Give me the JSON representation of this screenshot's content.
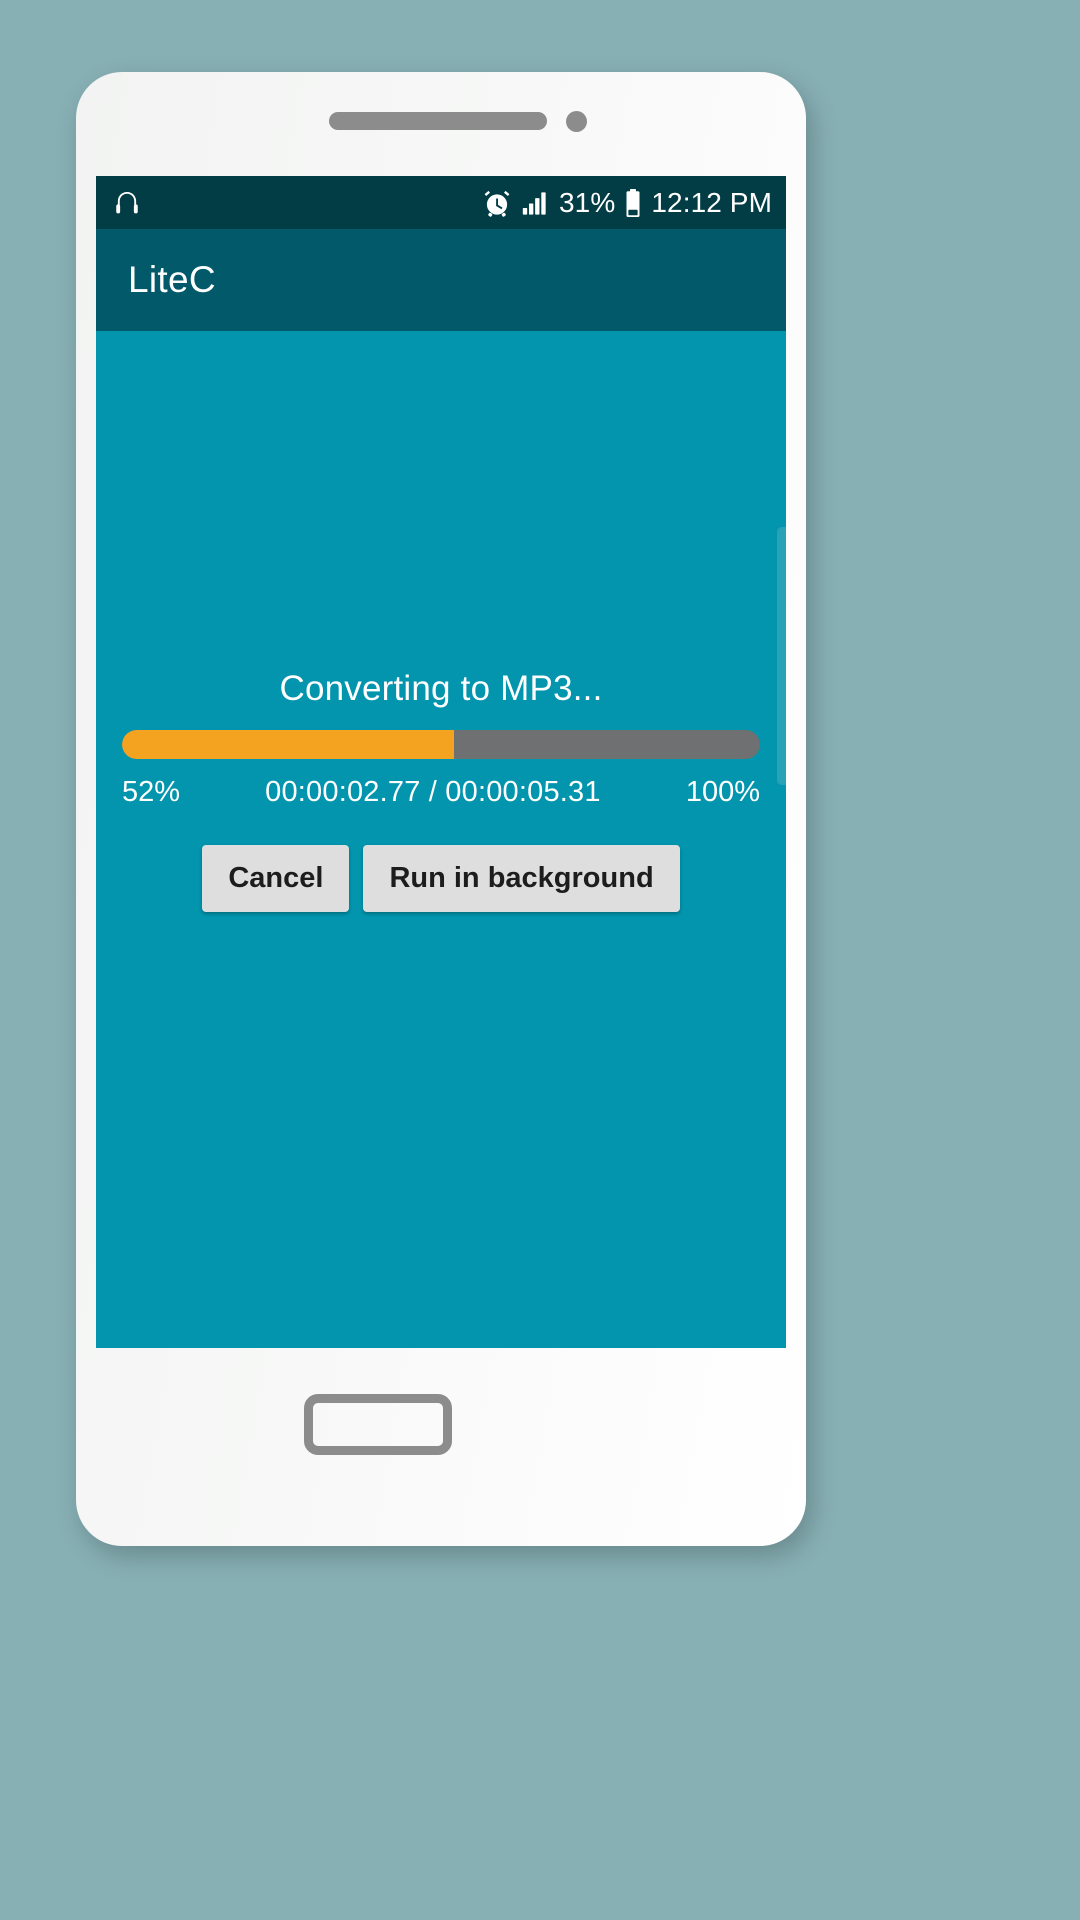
{
  "device": {
    "name": "android-phone-mockup",
    "speaker_icon": "speaker-grille",
    "camera_icon": "front-camera",
    "home_button_label": "home-button"
  },
  "status_bar": {
    "left_icons": [
      {
        "name": "headphones-icon",
        "label": "headphones"
      }
    ],
    "right_icons": [
      {
        "name": "alarm-clock-icon",
        "label": "alarm"
      },
      {
        "name": "signal-bars-icon",
        "label": "signal"
      },
      {
        "name": "battery-icon",
        "label": "battery"
      }
    ],
    "battery_percent": "31%",
    "clock": "12:12 PM",
    "background_color": "#023c45",
    "text_color": "#ffffff"
  },
  "app_bar": {
    "title": "LiteC",
    "background_color": "#02596a"
  },
  "content": {
    "background_color": "#0295ad"
  },
  "progress_dialog": {
    "status_text": "Converting to MP3...",
    "percent_value": 52,
    "min_label": "52%",
    "max_label": "100%",
    "time_label": "00:00:02.77 / 00:00:05.31",
    "elapsed_time": "00:00:02.77",
    "total_time": "00:00:05.31",
    "fill_color": "#f4a321",
    "track_color": "#6e7071",
    "buttons": [
      {
        "name": "cancel-button",
        "label": "Cancel"
      },
      {
        "name": "run-in-background-button",
        "label": "Run in background"
      }
    ]
  }
}
